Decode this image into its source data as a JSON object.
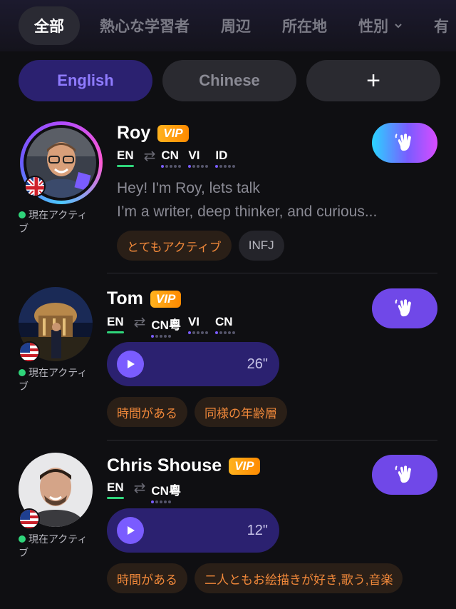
{
  "top_tabs": [
    {
      "label": "全部",
      "active": true
    },
    {
      "label": "熱心な学習者"
    },
    {
      "label": "周辺"
    },
    {
      "label": "所在地"
    },
    {
      "label": "性別",
      "has_dropdown": true
    },
    {
      "label": "有"
    }
  ],
  "language_filters": [
    {
      "label": "English",
      "active": true
    },
    {
      "label": "Chinese"
    },
    {
      "label": "+"
    }
  ],
  "users": [
    {
      "name": "Roy",
      "vip_label": "VIP",
      "flag": "UK",
      "status": "現在アクティブ",
      "native_lang": "EN",
      "learning_langs": [
        {
          "code": "CN",
          "level": 1
        },
        {
          "code": "VI",
          "level": 1
        },
        {
          "code": "ID",
          "level": 1
        }
      ],
      "bio_line1": "Hey! I'm Roy, lets talk",
      "bio_line2": "I’m a writer, deep thinker, and curious...",
      "tags": [
        "とてもアクティブ",
        "INFJ"
      ],
      "wave_icon": "wave-hand-icon"
    },
    {
      "name": "Tom",
      "vip_label": "VIP",
      "flag": "US",
      "status": "現在アクティブ",
      "native_lang": "EN",
      "learning_langs": [
        {
          "code": "CN粵",
          "level": 1
        },
        {
          "code": "VI",
          "level": 1
        },
        {
          "code": "CN",
          "level": 1
        }
      ],
      "voice_duration": "26\"",
      "tags": [
        "時間がある",
        "同様の年齢層"
      ],
      "wave_icon": "wave-hand-icon"
    },
    {
      "name": "Chris Shouse",
      "vip_label": "VIP",
      "flag": "US",
      "status": "現在アクティブ",
      "native_lang": "EN",
      "learning_langs": [
        {
          "code": "CN粵",
          "level": 1
        }
      ],
      "voice_duration": "12\"",
      "tags": [
        "時間がある",
        "二人ともお絵描きが好き,歌う,音楽"
      ],
      "wave_icon": "wave-hand-icon"
    }
  ]
}
